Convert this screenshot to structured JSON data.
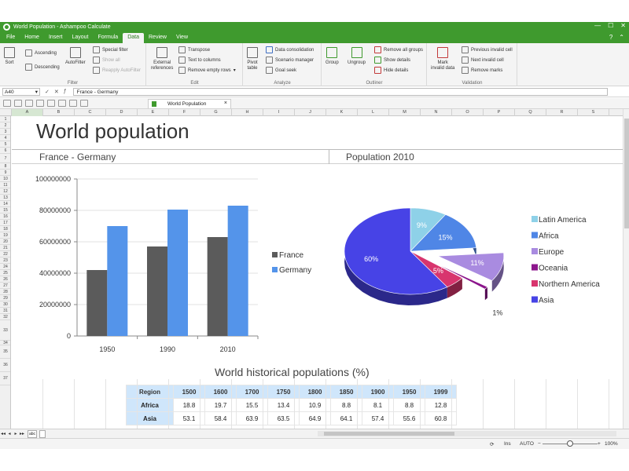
{
  "window": {
    "title": "World Population - Ashampoo Calculate",
    "controls": [
      "—",
      "☐",
      "✕"
    ]
  },
  "menu": {
    "items": [
      "File",
      "Home",
      "Insert",
      "Layout",
      "Formula",
      "Data",
      "Review",
      "View"
    ],
    "active": "Data",
    "right_icons": [
      "?",
      "⌃"
    ]
  },
  "ribbon": {
    "filter": {
      "label": "Filter",
      "sort": "Sort",
      "ascending": "Ascending",
      "descending": "Descending",
      "autofilter": "AutoFilter",
      "special_filter": "Special filter",
      "show_all": "Show all",
      "reapply_autofilter": "Reapply AutoFilter"
    },
    "edit": {
      "label": "Edit",
      "external_references_1": "External",
      "external_references_2": "references",
      "transpose": "Transpose",
      "text_to_columns": "Text to columns",
      "remove_empty_rows": "Remove empty rows"
    },
    "analyze": {
      "label": "Analyze",
      "pivot_1": "Pivot",
      "pivot_2": "table",
      "data_consolidation": "Data consolidation",
      "scenario_manager": "Scenario manager",
      "goal_seek": "Goal seek"
    },
    "outliner": {
      "label": "Outliner",
      "group": "Group",
      "ungroup": "Ungroup",
      "remove_all_groups": "Remove all groups",
      "show_details": "Show details",
      "hide_details": "Hide details"
    },
    "validation": {
      "label": "Validation",
      "mark_invalid_1": "Mark",
      "mark_invalid_2": "invalid data",
      "previous_invalid_cell": "Previous invalid cell",
      "next_invalid_cell": "Next invalid cell",
      "remove_marks": "Remove marks"
    }
  },
  "formula_bar": {
    "cell_ref": "A40",
    "content": "France - Germany"
  },
  "document_tab": {
    "name": "World Population"
  },
  "columns": [
    "A",
    "B",
    "C",
    "D",
    "E",
    "F",
    "G",
    "H",
    "I",
    "J",
    "K",
    "L",
    "M",
    "N",
    "O",
    "P",
    "Q",
    "R",
    "S"
  ],
  "rows": [
    "1",
    "2",
    "3",
    "4",
    "5",
    "6",
    "7",
    "8",
    "9",
    "10",
    "11",
    "12",
    "13",
    "14",
    "15",
    "16",
    "17",
    "18",
    "19",
    "20",
    "21",
    "22",
    "23",
    "24",
    "25",
    "26",
    "27",
    "28",
    "29",
    "30",
    "31",
    "32",
    "33",
    "34",
    "35",
    "36",
    "37"
  ],
  "sheet": {
    "title": "World population",
    "left_subtitle": "France - Germany",
    "right_subtitle": "Population 2010",
    "table_title": "World historical populations (%)"
  },
  "chart_data": [
    {
      "type": "bar",
      "categories": [
        "1950",
        "1990",
        "2010"
      ],
      "series": [
        {
          "name": "France",
          "values": [
            42000000,
            57000000,
            63000000
          ],
          "color": "#5b5b5b"
        },
        {
          "name": "Germany",
          "values": [
            70000000,
            80500000,
            83000000
          ],
          "color": "#5494ea"
        }
      ],
      "ylim": [
        0,
        100000000
      ],
      "yticks": [
        "0",
        "20000000",
        "40000000",
        "60000000",
        "80000000",
        "100000000"
      ],
      "grid": true,
      "legend": "right"
    },
    {
      "type": "pie",
      "title": "Population 2010",
      "slices": [
        {
          "name": "Latin America",
          "value": 9,
          "label": "9%",
          "color": "#8ed1e8"
        },
        {
          "name": "Africa",
          "value": 15,
          "label": "15%",
          "color": "#4f86e6"
        },
        {
          "name": "Europe",
          "value": 11,
          "label": "11%",
          "color": "#a98be0"
        },
        {
          "name": "Oceania",
          "value": 1,
          "label": "1%",
          "color": "#8c168c"
        },
        {
          "name": "Northern America",
          "value": 5,
          "label": "5%",
          "color": "#d8356e"
        },
        {
          "name": "Asia",
          "value": 60,
          "label": "60%",
          "color": "#4743e6"
        }
      ],
      "legend": "right"
    }
  ],
  "table": {
    "header": [
      "Region",
      "1500",
      "1600",
      "1700",
      "1750",
      "1800",
      "1850",
      "1900",
      "1950",
      "1999"
    ],
    "rows": [
      [
        "Africa",
        "18.8",
        "19.7",
        "15.5",
        "13.4",
        "10.9",
        "8.8",
        "8.1",
        "8.8",
        "12.8"
      ],
      [
        "Asia",
        "53.1",
        "58.4",
        "63.9",
        "63.5",
        "64.9",
        "64.1",
        "57.4",
        "55.6",
        "60.8"
      ]
    ]
  },
  "sheet_tabs": {
    "nav": [
      "◂◂",
      "◂",
      "▸",
      "▸▸"
    ],
    "sheet_icon": "abc"
  },
  "status": {
    "mode": "Ins",
    "calc": "AUTO",
    "zoom": "100%",
    "zoom_minus": "−",
    "zoom_plus": "+"
  }
}
